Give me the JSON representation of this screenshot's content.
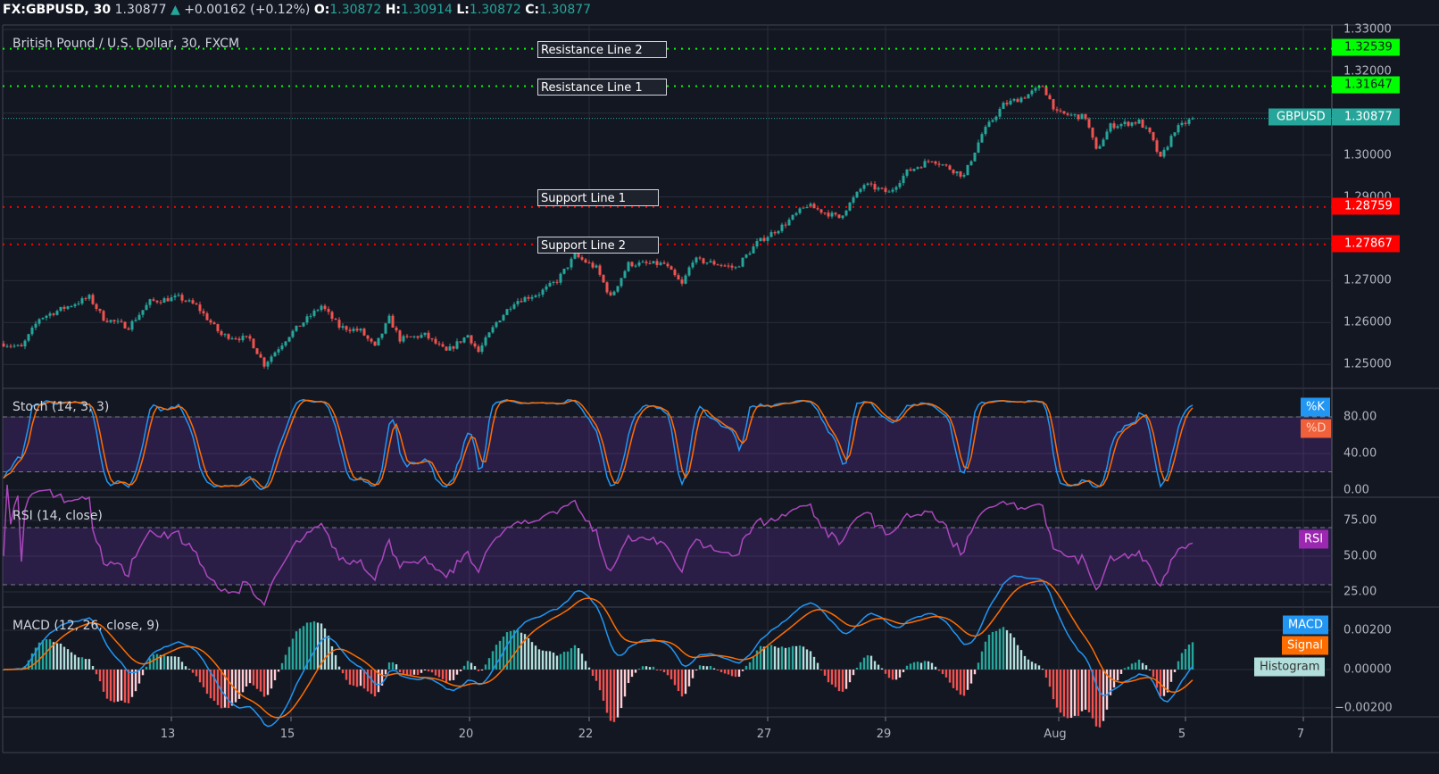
{
  "header": {
    "symbol": "FX:GBPUSD, 30",
    "last": "1.30877",
    "arrow": "▲",
    "change": "+0.00162 (+0.12%)",
    "o_label": "O:",
    "o": "1.30872",
    "h_label": "H:",
    "h": "1.30914",
    "l_label": "L:",
    "l": "1.30872",
    "c_label": "C:",
    "c": "1.30877"
  },
  "legend": {
    "main": "British Pound / U.S. Dollar, 30, FXCM",
    "stoch": "Stoch (14, 3, 3)",
    "rsi": "RSI (14, close)",
    "macd": "MACD (12, 26, close, 9)"
  },
  "drawings": {
    "r2": "Resistance Line 2",
    "r1": "Resistance Line 1",
    "s1": "Support Line 1",
    "s2": "Support Line 2"
  },
  "price_scale": [
    "1.33000",
    "1.32000",
    "1.30000",
    "1.29000",
    "1.27000",
    "1.26000",
    "1.25000"
  ],
  "tags": {
    "r2": "1.32539",
    "r1": "1.31647",
    "symbol": "GBPUSD",
    "last": "1.30877",
    "s1": "1.28759",
    "s2": "1.27867"
  },
  "stoch_scale": [
    "80.00",
    "40.00",
    "0.00"
  ],
  "rsi_scale": [
    "75.00",
    "50.00",
    "25.00"
  ],
  "macd_scale": [
    "0.00200",
    "0.00000",
    "−0.00200"
  ],
  "badges": {
    "k": "%K",
    "d": "%D",
    "rsi": "RSI",
    "macd": "MACD",
    "signal": "Signal",
    "hist": "Histogram"
  },
  "time_axis": [
    "13",
    "15",
    "20",
    "22",
    "27",
    "29",
    "Aug",
    "5",
    "7"
  ],
  "colors": {
    "bg": "#131722",
    "up": "#26a69a",
    "down": "#ef5350",
    "k": "#2196f3",
    "d": "#ff6d00",
    "rsi": "#ab47bc",
    "res": "#00ff00",
    "sup": "#ff0000"
  },
  "chart_data": {
    "type": "candlestick",
    "title": "FX:GBPUSD, 30",
    "ylim": [
      1.245,
      1.332
    ],
    "levels": {
      "resistance": [
        1.32539,
        1.31647
      ],
      "support": [
        1.28759,
        1.27867
      ],
      "last": 1.30877
    },
    "time_ticks": [
      {
        "label": "13",
        "bar": 47
      },
      {
        "label": "15",
        "bar": 80.5
      },
      {
        "label": "20",
        "bar": 130.5
      },
      {
        "label": "22",
        "bar": 164
      },
      {
        "label": "27",
        "bar": 214
      },
      {
        "label": "29",
        "bar": 247
      },
      {
        "label": "Aug",
        "bar": 295.5
      },
      {
        "label": "5",
        "bar": 331
      },
      {
        "label": "7",
        "bar": 364
      }
    ],
    "bars": 334,
    "close_path": [
      [
        0,
        1.255
      ],
      [
        5,
        1.254
      ],
      [
        10,
        1.261
      ],
      [
        24,
        1.266
      ],
      [
        28,
        1.261
      ],
      [
        35,
        1.259
      ],
      [
        41,
        1.265
      ],
      [
        49,
        1.266
      ],
      [
        54,
        1.264
      ],
      [
        61,
        1.257
      ],
      [
        69,
        1.256
      ],
      [
        73,
        1.25
      ],
      [
        80,
        1.257
      ],
      [
        89,
        1.264
      ],
      [
        94,
        1.259
      ],
      [
        100,
        1.258
      ],
      [
        104,
        1.254
      ],
      [
        108,
        1.261
      ],
      [
        111,
        1.256
      ],
      [
        118,
        1.257
      ],
      [
        124,
        1.253
      ],
      [
        130,
        1.257
      ],
      [
        133,
        1.253
      ],
      [
        138,
        1.26
      ],
      [
        143,
        1.265
      ],
      [
        150,
        1.267
      ],
      [
        155,
        1.27
      ],
      [
        160,
        1.276
      ],
      [
        166,
        1.273
      ],
      [
        170,
        1.266
      ],
      [
        175,
        1.274
      ],
      [
        185,
        1.274
      ],
      [
        190,
        1.269
      ],
      [
        193,
        1.275
      ],
      [
        200,
        1.274
      ],
      [
        205,
        1.273
      ],
      [
        211,
        1.279
      ],
      [
        218,
        1.283
      ],
      [
        225,
        1.288
      ],
      [
        234,
        1.285
      ],
      [
        241,
        1.293
      ],
      [
        248,
        1.291
      ],
      [
        253,
        1.296
      ],
      [
        260,
        1.299
      ],
      [
        269,
        1.295
      ],
      [
        274,
        1.305
      ],
      [
        280,
        1.312
      ],
      [
        286,
        1.314
      ],
      [
        291,
        1.3165
      ],
      [
        295,
        1.31
      ],
      [
        303,
        1.309
      ],
      [
        306,
        1.301
      ],
      [
        310,
        1.307
      ],
      [
        318,
        1.308
      ],
      [
        321,
        1.305
      ],
      [
        324,
        1.299
      ],
      [
        328,
        1.306
      ],
      [
        333,
        1.30877
      ]
    ],
    "indicators": {
      "stoch": {
        "k": 14,
        "smooth_k": 3,
        "d": 3,
        "bands": [
          80,
          20
        ]
      },
      "rsi": {
        "length": 14,
        "bands": [
          70,
          30
        ]
      },
      "macd": {
        "fast": 12,
        "slow": 26,
        "signal": 9
      }
    }
  }
}
